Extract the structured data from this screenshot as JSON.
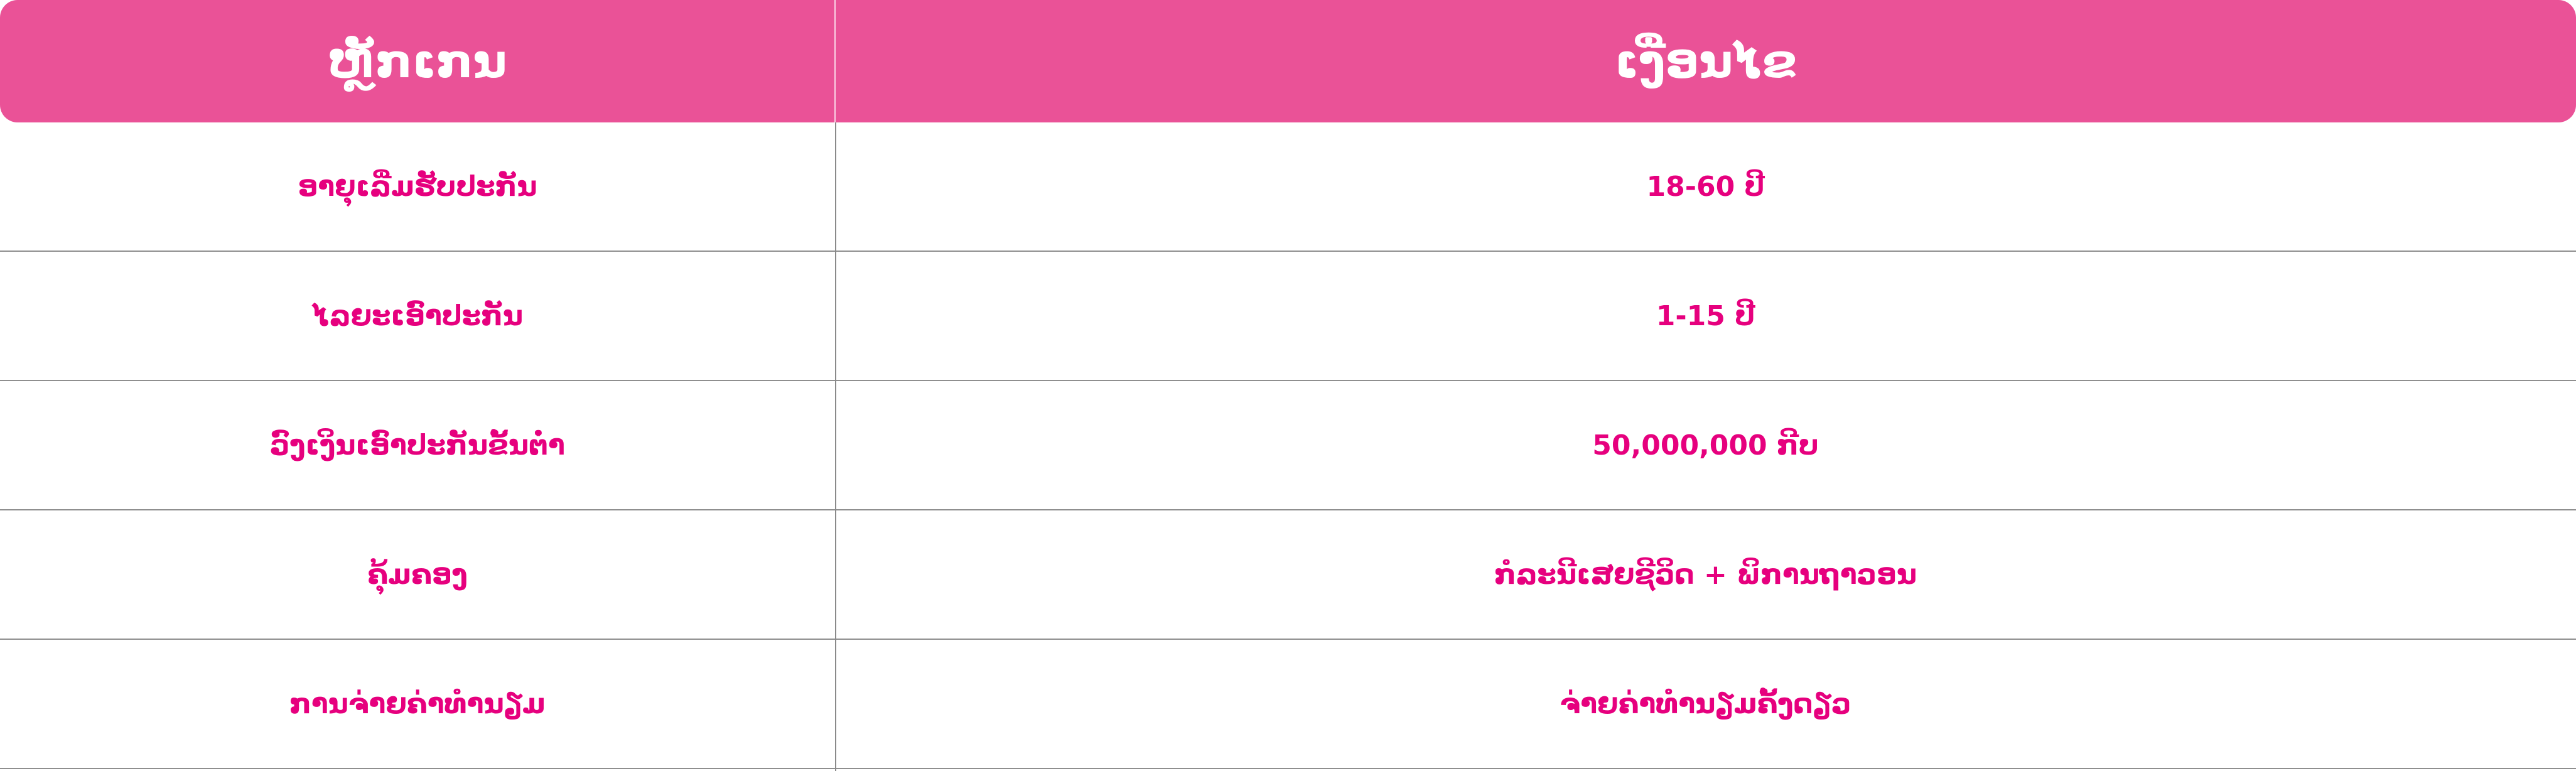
{
  "colors": {
    "header_bg": "#ea5297",
    "text_accent": "#e6007e",
    "divider": "#8f8f8f"
  },
  "table": {
    "headers": [
      "ຫຼັກເກນ",
      "ເງື່ອນໄຂ"
    ],
    "rows": [
      {
        "criterion": "ອາຍຸເລີ່ມຮັບປະກັນ",
        "condition": "18-60 ປີ"
      },
      {
        "criterion": "ໄລຍະເອົາປະກັນ",
        "condition": "1-15 ປີ"
      },
      {
        "criterion": "ວົງເງິນເອົາປະກັນຂັ້ນຕໍ່າ",
        "condition": "50,000,000 ກີບ"
      },
      {
        "criterion": "ຄຸ້ມຄອງ",
        "condition": "ກໍລະນີເສຍຊີວິດ + ພິການຖາວອນ"
      },
      {
        "criterion": "ການຈ່າຍຄ່າທຳນຽມ",
        "condition": "ຈ່າຍຄ່າທຳນຽມຄັ້ງດຽວ"
      }
    ]
  }
}
